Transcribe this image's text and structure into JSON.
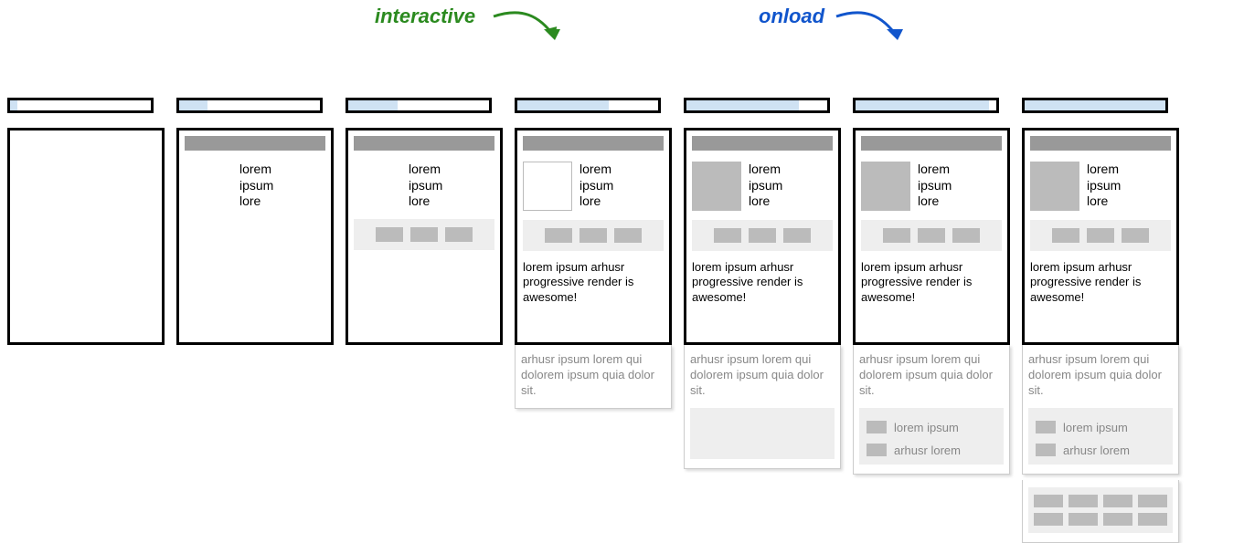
{
  "labels": {
    "interactive": "interactive",
    "onload": "onload"
  },
  "progress_percent": [
    5,
    20,
    35,
    65,
    80,
    95,
    100
  ],
  "placeholder_text": {
    "short3": "lorem\nipsum\nlore",
    "body": "lorem ipsum arhusr progressive render is awesome!",
    "grey_para": "arhusr ipsum lorem qui dolorem ipsum quia dolor sit.",
    "list_item1": "lorem ipsum",
    "list_item2": "arhusr lorem"
  }
}
